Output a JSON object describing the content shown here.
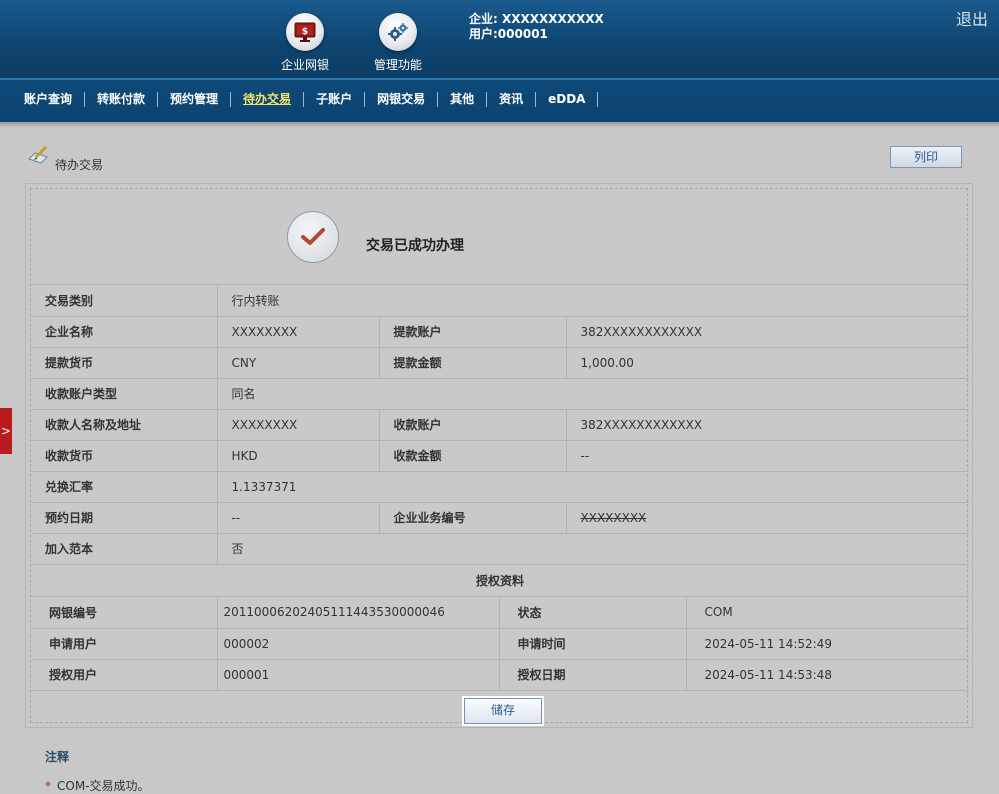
{
  "header": {
    "nav": [
      {
        "label": "企业网银",
        "icon": "monitor-dollar-icon"
      },
      {
        "label": "管理功能",
        "icon": "gears-icon"
      }
    ],
    "company_line": "企业: XXXXXXXXXXX",
    "user_line": "用户:000001",
    "logout": "退出"
  },
  "menu": [
    "账户查询",
    "转账付款",
    "预约管理",
    "待办交易",
    "子账户",
    "网银交易",
    "其他",
    "资讯",
    "eDDA"
  ],
  "menu_active_index": 3,
  "page": {
    "title": "待办交易",
    "print_label": "列印",
    "side_tab_glyph": ">"
  },
  "success": {
    "message": "交易已成功办理"
  },
  "details": {
    "rows": [
      {
        "l1": "交易类别",
        "v1": "行内转账"
      },
      {
        "l1": "企业名称",
        "v1": "XXXXXXXX",
        "l2": "提款账户",
        "v2": "382XXXXXXXXXXXX"
      },
      {
        "l1": "提款货币",
        "v1": "CNY",
        "l2": "提款金额",
        "v2": "1,000.00"
      },
      {
        "l1": "收款账户类型",
        "v1": "同名"
      },
      {
        "l1": "收款人名称及地址",
        "v1": "XXXXXXXX",
        "l2": "收款账户",
        "v2": "382XXXXXXXXXXXX"
      },
      {
        "l1": "收款货币",
        "v1": "HKD",
        "l2": "收款金额",
        "v2": "--"
      },
      {
        "l1": "兑换汇率",
        "v1": "1.1337371"
      },
      {
        "l1": "预约日期",
        "v1": "--",
        "l2": "企业业务编号",
        "v2": "XXXXXXXX"
      },
      {
        "l1": "加入范本",
        "v1": "否"
      }
    ]
  },
  "auth": {
    "title": "授权资料",
    "rows": [
      {
        "l1": "网银编号",
        "v1": "20110006202405111443530000046",
        "l2": "状态",
        "v2": "COM"
      },
      {
        "l1": "申请用户",
        "v1": "000002",
        "l2": "申请时间",
        "v2": "2024-05-11 14:52:49"
      },
      {
        "l1": "授权用户",
        "v1": "000001",
        "l2": "授权日期",
        "v2": "2024-05-11 14:53:48"
      }
    ]
  },
  "save_label": "储存",
  "notes": {
    "title": "注释",
    "items": [
      {
        "star": "*",
        "text": "COM-交易成功。"
      }
    ]
  },
  "colors": {
    "header": "#0e4672",
    "accent_red": "#c8202a",
    "menu_active": "#f3e36a"
  }
}
